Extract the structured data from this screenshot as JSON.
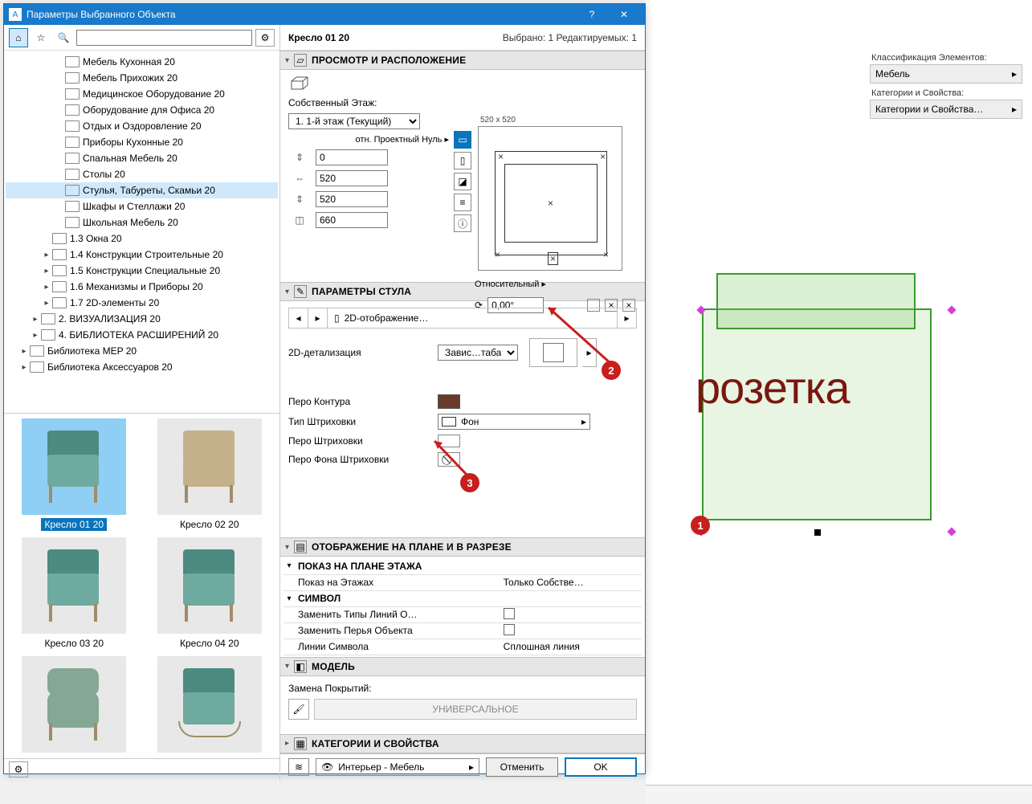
{
  "dialog": {
    "title": "Параметры Выбранного Объекта",
    "help": "?",
    "close": "✕"
  },
  "header": {
    "object_name": "Кресло 01 20",
    "selection": "Выбрано: 1 Редактируемых: 1"
  },
  "tree": {
    "items": [
      {
        "indent": 60,
        "label": "Мебель Кухонная 20"
      },
      {
        "indent": 60,
        "label": "Мебель Прихожих 20"
      },
      {
        "indent": 60,
        "label": "Медицинское Оборудование 20"
      },
      {
        "indent": 60,
        "label": "Оборудование для Офиса 20"
      },
      {
        "indent": 60,
        "label": "Отдых и Оздоровление 20"
      },
      {
        "indent": 60,
        "label": "Приборы Кухонные 20"
      },
      {
        "indent": 60,
        "label": "Спальная Мебель 20"
      },
      {
        "indent": 60,
        "label": "Столы 20"
      },
      {
        "indent": 60,
        "label": "Стулья, Табуреты, Скамьи 20",
        "selected": true
      },
      {
        "indent": 60,
        "label": "Шкафы и Стеллажи 20"
      },
      {
        "indent": 60,
        "label": "Школьная Мебель 20"
      },
      {
        "indent": 44,
        "label": "1.3 Окна 20"
      },
      {
        "indent": 44,
        "label": "1.4 Конструкции Строительные 20",
        "exp": "▸"
      },
      {
        "indent": 44,
        "label": "1.5 Конструкции Специальные 20",
        "exp": "▸"
      },
      {
        "indent": 44,
        "label": "1.6 Механизмы и Приборы 20",
        "exp": "▸"
      },
      {
        "indent": 44,
        "label": "1.7 2D-элементы 20",
        "exp": "▸"
      },
      {
        "indent": 30,
        "label": "2. ВИЗУАЛИЗАЦИЯ 20",
        "exp": "▸"
      },
      {
        "indent": 30,
        "label": "4. БИБЛИОТЕКА РАСШИРЕНИЙ 20",
        "exp": "▸"
      },
      {
        "indent": 16,
        "label": "Библиотека MEP 20",
        "exp": "▸"
      },
      {
        "indent": 16,
        "label": "Библиотека Аксессуаров 20",
        "exp": "▸"
      }
    ]
  },
  "thumbs": [
    {
      "caption": "Кресло 01 20",
      "selected": true
    },
    {
      "caption": "Кресло 02 20"
    },
    {
      "caption": "Кресло 03 20"
    },
    {
      "caption": "Кресло 04 20"
    },
    {
      "caption": "",
      "soft": true
    },
    {
      "caption": "",
      "rocker": true
    }
  ],
  "panels": {
    "placement": {
      "title": "ПРОСМОТР И РАСПОЛОЖЕНИЕ",
      "own_floor": "Собственный Этаж:",
      "floor_sel": "1. 1-й этаж (Текущий)",
      "rel_zero": "отн. Проектный Нуль ▸",
      "z": "0",
      "w": "520",
      "d": "520",
      "h": "660",
      "plan_size": "520 x 520",
      "relative": "Относительный ▸",
      "angle": "0,00°"
    },
    "chair": {
      "title": "ПАРАМЕТРЫ СТУЛА",
      "tab": "2D-отображение…",
      "detail_lbl": "2D-детализация",
      "detail_val": "Завис…таба",
      "pen_contour": "Перо Контура",
      "hatch_type": "Тип Штриховки",
      "hatch_val": "Фон",
      "pen_hatch": "Перо Штриховки",
      "pen_bg": "Перо Фона Штриховки"
    },
    "plan": {
      "title": "ОТОБРАЖЕНИЕ НА ПЛАНЕ И В РАЗРЕЗЕ",
      "r1": "ПОКАЗ НА ПЛАНЕ ЭТАЖА",
      "r2": "Показ на Этажах",
      "r2v": "Только Собстве…",
      "r3": "СИМВОЛ",
      "r4": "Заменить Типы Линий О…",
      "r5": "Заменить Перья Объекта",
      "r6": "Линии Символа",
      "r6v": "Сплошная линия"
    },
    "model": {
      "title": "МОДЕЛЬ",
      "repl": "Замена Покрытий:",
      "univ": "УНИВЕРСАЛЬНОЕ"
    },
    "cat": {
      "title": "КАТЕГОРИИ И СВОЙСТВА"
    }
  },
  "footer": {
    "layer": "Интерьер - Мебель",
    "cancel": "Отменить",
    "ok": "OK"
  },
  "side": {
    "class_lbl": "Классификация Элементов:",
    "class_val": "Мебель",
    "cat_lbl": "Категории и Свойства:",
    "cat_val": "Категории и Свойства…"
  },
  "canvas": {
    "text": "розетка"
  },
  "callouts": {
    "c1": "1",
    "c2": "2",
    "c3": "3"
  }
}
